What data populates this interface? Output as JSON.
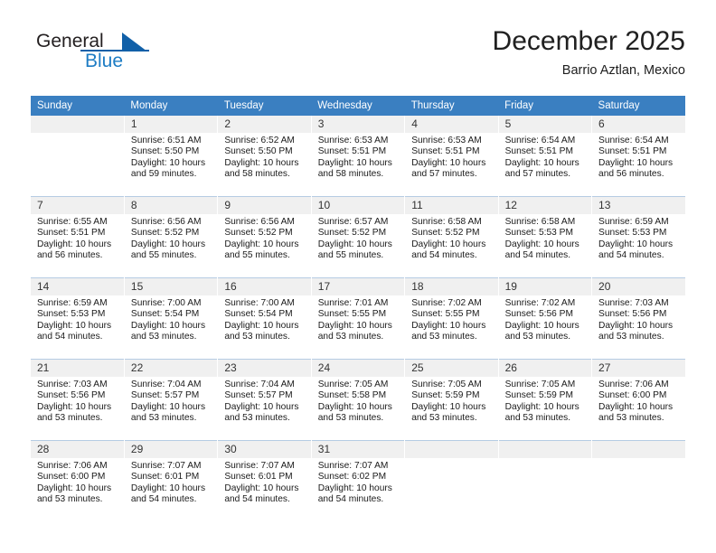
{
  "brand": {
    "name_part1": "General",
    "name_part2": "Blue",
    "logo_icon": "triangle-icon"
  },
  "header": {
    "title": "December 2025",
    "subtitle": "Barrio Aztlan, Mexico"
  },
  "calendar": {
    "weekday_headers": [
      "Sunday",
      "Monday",
      "Tuesday",
      "Wednesday",
      "Thursday",
      "Friday",
      "Saturday"
    ],
    "weeks": [
      [
        {
          "day": "",
          "sunrise": "",
          "sunset": "",
          "daylight": "",
          "daylight2": ""
        },
        {
          "day": "1",
          "sunrise": "Sunrise: 6:51 AM",
          "sunset": "Sunset: 5:50 PM",
          "daylight": "Daylight: 10 hours",
          "daylight2": "and 59 minutes."
        },
        {
          "day": "2",
          "sunrise": "Sunrise: 6:52 AM",
          "sunset": "Sunset: 5:50 PM",
          "daylight": "Daylight: 10 hours",
          "daylight2": "and 58 minutes."
        },
        {
          "day": "3",
          "sunrise": "Sunrise: 6:53 AM",
          "sunset": "Sunset: 5:51 PM",
          "daylight": "Daylight: 10 hours",
          "daylight2": "and 58 minutes."
        },
        {
          "day": "4",
          "sunrise": "Sunrise: 6:53 AM",
          "sunset": "Sunset: 5:51 PM",
          "daylight": "Daylight: 10 hours",
          "daylight2": "and 57 minutes."
        },
        {
          "day": "5",
          "sunrise": "Sunrise: 6:54 AM",
          "sunset": "Sunset: 5:51 PM",
          "daylight": "Daylight: 10 hours",
          "daylight2": "and 57 minutes."
        },
        {
          "day": "6",
          "sunrise": "Sunrise: 6:54 AM",
          "sunset": "Sunset: 5:51 PM",
          "daylight": "Daylight: 10 hours",
          "daylight2": "and 56 minutes."
        }
      ],
      [
        {
          "day": "7",
          "sunrise": "Sunrise: 6:55 AM",
          "sunset": "Sunset: 5:51 PM",
          "daylight": "Daylight: 10 hours",
          "daylight2": "and 56 minutes."
        },
        {
          "day": "8",
          "sunrise": "Sunrise: 6:56 AM",
          "sunset": "Sunset: 5:52 PM",
          "daylight": "Daylight: 10 hours",
          "daylight2": "and 55 minutes."
        },
        {
          "day": "9",
          "sunrise": "Sunrise: 6:56 AM",
          "sunset": "Sunset: 5:52 PM",
          "daylight": "Daylight: 10 hours",
          "daylight2": "and 55 minutes."
        },
        {
          "day": "10",
          "sunrise": "Sunrise: 6:57 AM",
          "sunset": "Sunset: 5:52 PM",
          "daylight": "Daylight: 10 hours",
          "daylight2": "and 55 minutes."
        },
        {
          "day": "11",
          "sunrise": "Sunrise: 6:58 AM",
          "sunset": "Sunset: 5:52 PM",
          "daylight": "Daylight: 10 hours",
          "daylight2": "and 54 minutes."
        },
        {
          "day": "12",
          "sunrise": "Sunrise: 6:58 AM",
          "sunset": "Sunset: 5:53 PM",
          "daylight": "Daylight: 10 hours",
          "daylight2": "and 54 minutes."
        },
        {
          "day": "13",
          "sunrise": "Sunrise: 6:59 AM",
          "sunset": "Sunset: 5:53 PM",
          "daylight": "Daylight: 10 hours",
          "daylight2": "and 54 minutes."
        }
      ],
      [
        {
          "day": "14",
          "sunrise": "Sunrise: 6:59 AM",
          "sunset": "Sunset: 5:53 PM",
          "daylight": "Daylight: 10 hours",
          "daylight2": "and 54 minutes."
        },
        {
          "day": "15",
          "sunrise": "Sunrise: 7:00 AM",
          "sunset": "Sunset: 5:54 PM",
          "daylight": "Daylight: 10 hours",
          "daylight2": "and 53 minutes."
        },
        {
          "day": "16",
          "sunrise": "Sunrise: 7:00 AM",
          "sunset": "Sunset: 5:54 PM",
          "daylight": "Daylight: 10 hours",
          "daylight2": "and 53 minutes."
        },
        {
          "day": "17",
          "sunrise": "Sunrise: 7:01 AM",
          "sunset": "Sunset: 5:55 PM",
          "daylight": "Daylight: 10 hours",
          "daylight2": "and 53 minutes."
        },
        {
          "day": "18",
          "sunrise": "Sunrise: 7:02 AM",
          "sunset": "Sunset: 5:55 PM",
          "daylight": "Daylight: 10 hours",
          "daylight2": "and 53 minutes."
        },
        {
          "day": "19",
          "sunrise": "Sunrise: 7:02 AM",
          "sunset": "Sunset: 5:56 PM",
          "daylight": "Daylight: 10 hours",
          "daylight2": "and 53 minutes."
        },
        {
          "day": "20",
          "sunrise": "Sunrise: 7:03 AM",
          "sunset": "Sunset: 5:56 PM",
          "daylight": "Daylight: 10 hours",
          "daylight2": "and 53 minutes."
        }
      ],
      [
        {
          "day": "21",
          "sunrise": "Sunrise: 7:03 AM",
          "sunset": "Sunset: 5:56 PM",
          "daylight": "Daylight: 10 hours",
          "daylight2": "and 53 minutes."
        },
        {
          "day": "22",
          "sunrise": "Sunrise: 7:04 AM",
          "sunset": "Sunset: 5:57 PM",
          "daylight": "Daylight: 10 hours",
          "daylight2": "and 53 minutes."
        },
        {
          "day": "23",
          "sunrise": "Sunrise: 7:04 AM",
          "sunset": "Sunset: 5:57 PM",
          "daylight": "Daylight: 10 hours",
          "daylight2": "and 53 minutes."
        },
        {
          "day": "24",
          "sunrise": "Sunrise: 7:05 AM",
          "sunset": "Sunset: 5:58 PM",
          "daylight": "Daylight: 10 hours",
          "daylight2": "and 53 minutes."
        },
        {
          "day": "25",
          "sunrise": "Sunrise: 7:05 AM",
          "sunset": "Sunset: 5:59 PM",
          "daylight": "Daylight: 10 hours",
          "daylight2": "and 53 minutes."
        },
        {
          "day": "26",
          "sunrise": "Sunrise: 7:05 AM",
          "sunset": "Sunset: 5:59 PM",
          "daylight": "Daylight: 10 hours",
          "daylight2": "and 53 minutes."
        },
        {
          "day": "27",
          "sunrise": "Sunrise: 7:06 AM",
          "sunset": "Sunset: 6:00 PM",
          "daylight": "Daylight: 10 hours",
          "daylight2": "and 53 minutes."
        }
      ],
      [
        {
          "day": "28",
          "sunrise": "Sunrise: 7:06 AM",
          "sunset": "Sunset: 6:00 PM",
          "daylight": "Daylight: 10 hours",
          "daylight2": "and 53 minutes."
        },
        {
          "day": "29",
          "sunrise": "Sunrise: 7:07 AM",
          "sunset": "Sunset: 6:01 PM",
          "daylight": "Daylight: 10 hours",
          "daylight2": "and 54 minutes."
        },
        {
          "day": "30",
          "sunrise": "Sunrise: 7:07 AM",
          "sunset": "Sunset: 6:01 PM",
          "daylight": "Daylight: 10 hours",
          "daylight2": "and 54 minutes."
        },
        {
          "day": "31",
          "sunrise": "Sunrise: 7:07 AM",
          "sunset": "Sunset: 6:02 PM",
          "daylight": "Daylight: 10 hours",
          "daylight2": "and 54 minutes."
        },
        {
          "day": "",
          "sunrise": "",
          "sunset": "",
          "daylight": "",
          "daylight2": ""
        },
        {
          "day": "",
          "sunrise": "",
          "sunset": "",
          "daylight": "",
          "daylight2": ""
        },
        {
          "day": "",
          "sunrise": "",
          "sunset": "",
          "daylight": "",
          "daylight2": ""
        }
      ]
    ]
  },
  "colors": {
    "header_blue": "#3a7fc1",
    "brand_blue": "#1160a8",
    "daynum_bg": "#f0f0f0",
    "row_divider": "#b5cce3"
  }
}
